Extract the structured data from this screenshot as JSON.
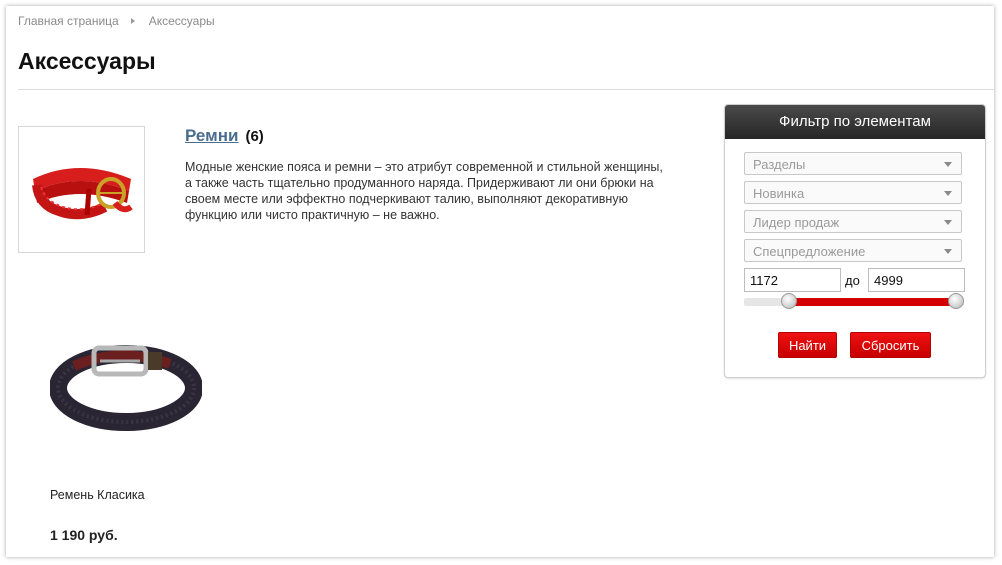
{
  "breadcrumb": {
    "home": "Главная страница",
    "current": "Аксессуары"
  },
  "page": {
    "title": "Аксессуары"
  },
  "category": {
    "name": "Ремни",
    "count": "(6)",
    "description": "Модные женские пояса и ремни – это атрибут современной и стильной женщины, а также часть тщательно продуманного наряда. Придерживают ли они брюки на своем месте или эффектно подчеркивают талию, выполняют декоративную функцию или чисто практичную – не важно."
  },
  "product": {
    "name": "Ремень Класика",
    "price": "1 190 руб."
  },
  "filter": {
    "title": "Фильтр по элементам",
    "selects": [
      "Разделы",
      "Новинка",
      "Лидер продаж",
      "Спецпредложение"
    ],
    "price_from": "1172",
    "price_to": "4999",
    "separator": "до",
    "range_low_fraction": 0.18,
    "range_high_fraction": 1.0,
    "find_label": "Найти",
    "reset_label": "Сбросить"
  },
  "colors": {
    "accent": "#d40000",
    "link": "#4a6d8f",
    "header_bg": "#2b2b2b"
  }
}
